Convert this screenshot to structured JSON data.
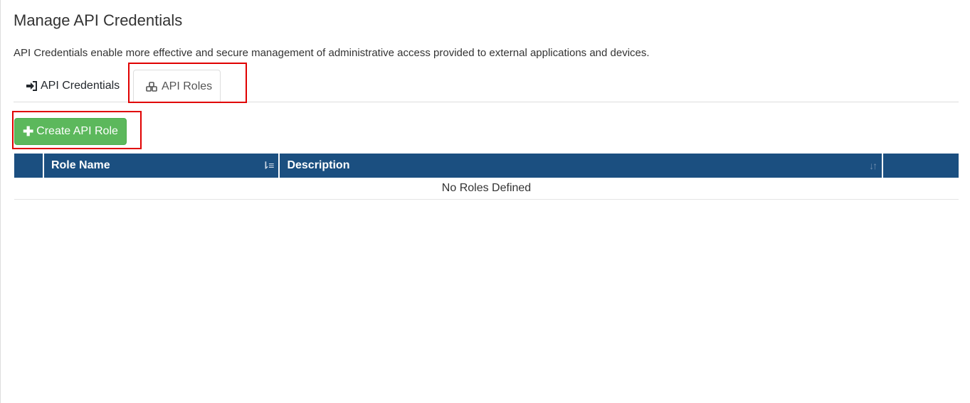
{
  "page": {
    "title": "Manage API Credentials",
    "description": "API Credentials enable more effective and secure management of administrative access provided to external applications and devices."
  },
  "tabs": [
    {
      "label": "API Credentials",
      "icon": "sign-in-icon",
      "active": false
    },
    {
      "label": "API Roles",
      "icon": "cubes-icon",
      "active": true
    }
  ],
  "toolbar": {
    "create_label": "Create API Role",
    "create_icon": "plus-icon"
  },
  "table": {
    "columns": [
      {
        "label": ""
      },
      {
        "label": "Role Name",
        "sort": "ascending"
      },
      {
        "label": "Description",
        "sort": "unsorted"
      },
      {
        "label": ""
      }
    ],
    "empty_message": "No Roles Defined"
  },
  "colors": {
    "header_bg": "#1b4f80",
    "button_green": "#5cb85c",
    "highlight_red": "#e00000"
  }
}
